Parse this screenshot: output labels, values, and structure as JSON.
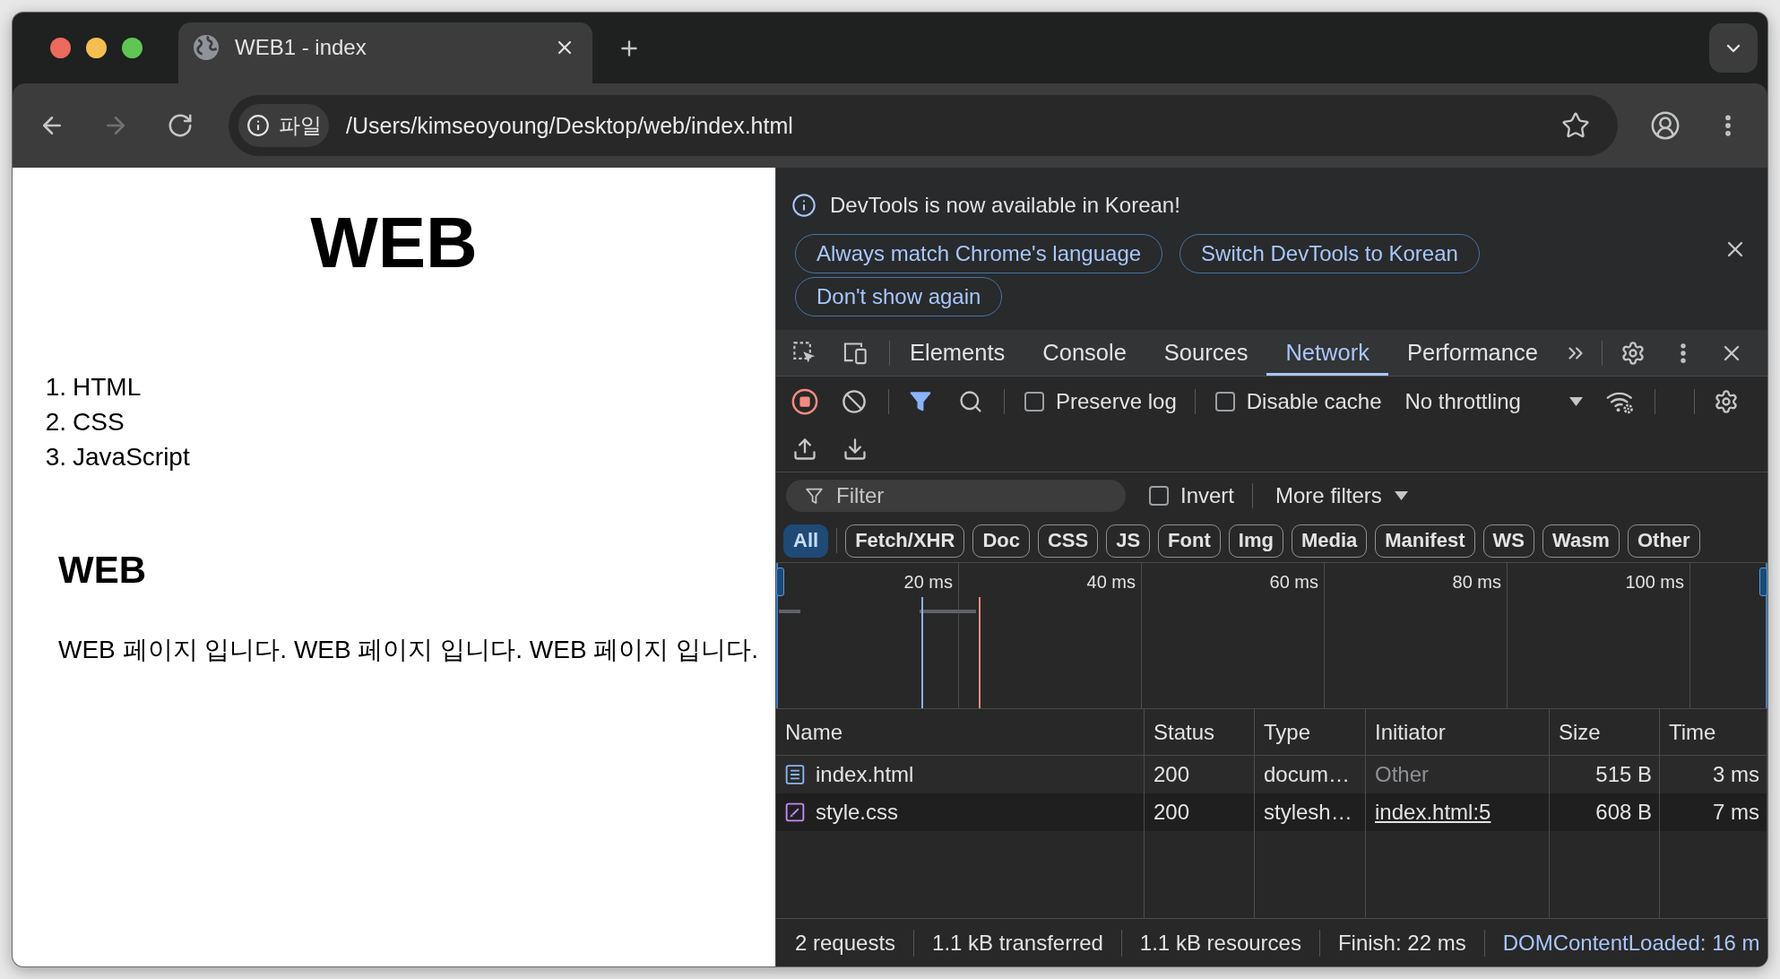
{
  "browser": {
    "tabs": [
      {
        "title": "WEB1 - index",
        "selected": true
      }
    ],
    "navigation": {
      "back": {
        "disabled": false
      },
      "forward": {
        "disabled": true
      }
    },
    "address_bar": {
      "chip": "파일",
      "url": "/Users/kimseoyoung/Desktop/web/index.html"
    }
  },
  "page": {
    "heading": "WEB",
    "list": [
      {
        "number": "1.",
        "text": "HTML"
      },
      {
        "number": "2.",
        "text": "CSS"
      },
      {
        "number": "3.",
        "text": "JavaScript"
      }
    ],
    "subheading": "WEB",
    "paragraph": "WEB 페이지 입니다. WEB 페이지 입니다. WEB 페이지 입니다."
  },
  "devtools": {
    "infobar": {
      "message": "DevTools is now available in Korean!",
      "buttons": [
        "Always match Chrome's language",
        "Switch DevTools to Korean",
        "Don't show again"
      ]
    },
    "panel_tabs": [
      {
        "label": "Elements",
        "selected": false
      },
      {
        "label": "Console",
        "selected": false
      },
      {
        "label": "Sources",
        "selected": false
      },
      {
        "label": "Network",
        "selected": true
      },
      {
        "label": "Performance",
        "selected": false
      }
    ],
    "network_toolbar": {
      "recording": true,
      "filters_shown": true,
      "options": [
        {
          "label": "Preserve log",
          "checked": false
        },
        {
          "label": "Disable cache",
          "checked": false
        }
      ],
      "throttling": "No throttling"
    },
    "filter_bar": {
      "placeholder": "Filter",
      "invert": {
        "label": "Invert",
        "checked": false
      },
      "more_filters": "More filters"
    },
    "type_filters": [
      {
        "label": "All",
        "selected": true
      },
      {
        "label": "Fetch/XHR",
        "selected": false
      },
      {
        "label": "Doc",
        "selected": false
      },
      {
        "label": "CSS",
        "selected": false
      },
      {
        "label": "JS",
        "selected": false
      },
      {
        "label": "Font",
        "selected": false
      },
      {
        "label": "Img",
        "selected": false
      },
      {
        "label": "Media",
        "selected": false
      },
      {
        "label": "Manifest",
        "selected": false
      },
      {
        "label": "WS",
        "selected": false
      },
      {
        "label": "Wasm",
        "selected": false
      },
      {
        "label": "Other",
        "selected": false
      }
    ],
    "timeline": {
      "tick_labels": [
        "20 ms",
        "40 ms",
        "60 ms",
        "80 ms",
        "100 ms"
      ]
    },
    "requests": {
      "columns": [
        "Name",
        "Status",
        "Type",
        "Initiator",
        "Size",
        "Time"
      ],
      "rows": [
        {
          "kind": "document",
          "name": "index.html",
          "status": "200",
          "type": "docum…",
          "initiator": "Other",
          "initiator_link": false,
          "size": "515 B",
          "time": "3 ms"
        },
        {
          "kind": "stylesheet",
          "name": "style.css",
          "status": "200",
          "type": "stylesh…",
          "initiator": "index.html:5",
          "initiator_link": true,
          "size": "608 B",
          "time": "7 ms"
        }
      ]
    },
    "status_bar": [
      {
        "text": "2 requests",
        "kind": "summary"
      },
      {
        "text": "1.1 kB transferred",
        "kind": "summary"
      },
      {
        "text": "1.1 kB resources",
        "kind": "summary"
      },
      {
        "text": "Finish: 22 ms",
        "kind": "summary"
      },
      {
        "text": "DOMContentLoaded: 16 m",
        "kind": "event"
      }
    ]
  }
}
